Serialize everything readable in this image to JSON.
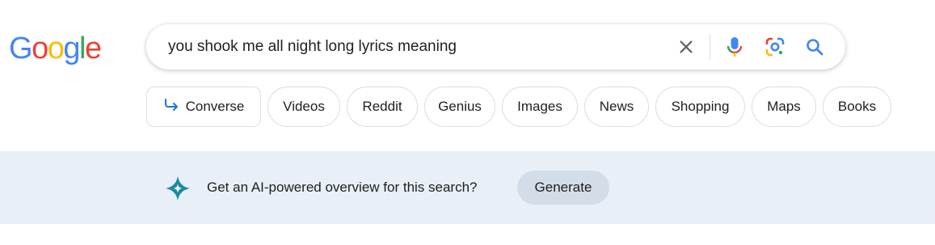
{
  "logo": {
    "letters": [
      "G",
      "o",
      "o",
      "g",
      "l",
      "e"
    ],
    "colors": [
      "#4285F4",
      "#EA4335",
      "#FBBC05",
      "#4285F4",
      "#34A853",
      "#EA4335"
    ]
  },
  "search": {
    "query": "you shook me all night long lyrics meaning",
    "icons": [
      "close-icon",
      "microphone-icon",
      "lens-icon",
      "search-icon"
    ]
  },
  "chips": [
    {
      "label": "Converse",
      "icon": "converse-arrow-icon"
    },
    {
      "label": "Videos"
    },
    {
      "label": "Reddit"
    },
    {
      "label": "Genius"
    },
    {
      "label": "Images"
    },
    {
      "label": "News"
    },
    {
      "label": "Shopping"
    },
    {
      "label": "Maps"
    },
    {
      "label": "Books"
    }
  ],
  "ai_overview": {
    "icon": "ai-sparkle-icon",
    "prompt": "Get an AI-powered overview for this search?",
    "button_label": "Generate"
  },
  "colors": {
    "accent_blue": "#1a73e8",
    "banner_bg": "#e8eff7",
    "button_bg": "#d3dde8",
    "ai_icon": "#1a8aa3"
  }
}
